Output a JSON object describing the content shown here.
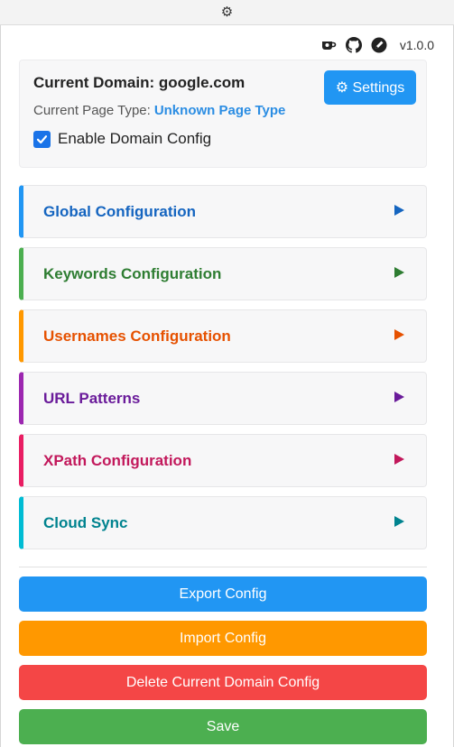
{
  "topbar": {
    "icon": "gear-icon",
    "glyph": "⚙"
  },
  "header": {
    "icons": [
      "coffee-icon",
      "github-icon",
      "pen-icon"
    ],
    "version": "v1.0.0"
  },
  "domain": {
    "title": "Current Domain: google.com",
    "page_type_label": "Current Page Type:",
    "page_type_value": "Unknown Page Type",
    "enable_label": "Enable Domain Config",
    "enable_checked": true,
    "settings_label": "⚙ Settings"
  },
  "sections": [
    {
      "label": "Global Configuration",
      "color": "#1565c0",
      "accent": "#2196f3"
    },
    {
      "label": "Keywords Configuration",
      "color": "#2e7d32",
      "accent": "#4caf50"
    },
    {
      "label": "Usernames Configuration",
      "color": "#e65100",
      "accent": "#ff9800"
    },
    {
      "label": "URL Patterns",
      "color": "#6a1b9a",
      "accent": "#9c27b0"
    },
    {
      "label": "XPath Configuration",
      "color": "#c2185b",
      "accent": "#e91e63"
    },
    {
      "label": "Cloud Sync",
      "color": "#00838f",
      "accent": "#00bcd4"
    }
  ],
  "actions": {
    "export": {
      "label": "Export Config",
      "color": "#2196f3"
    },
    "import": {
      "label": "Import Config",
      "color": "#ff9800"
    },
    "delete": {
      "label": "Delete Current Domain Config",
      "color": "#f44646"
    },
    "save": {
      "label": "Save",
      "color": "#4caf50"
    }
  }
}
